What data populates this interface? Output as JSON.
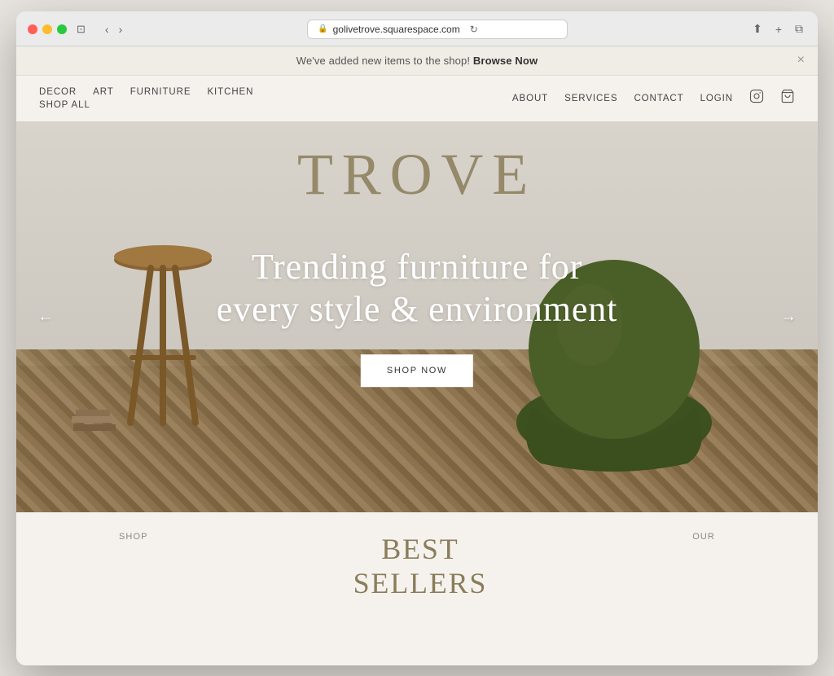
{
  "browser": {
    "url": "golivetrove.squarespace.com",
    "close_label": "×",
    "back_label": "‹",
    "forward_label": "›",
    "window_icon_label": "⧉",
    "share_label": "⬆",
    "add_tab_label": "+",
    "duplicate_label": "⧉",
    "window_toggle_label": "⊡"
  },
  "announcement": {
    "text": "We've added new items to the shop! ",
    "link_text": "Browse Now",
    "close_label": "×"
  },
  "nav": {
    "left_items": [
      {
        "label": "DECOR",
        "id": "decor"
      },
      {
        "label": "ART",
        "id": "art"
      },
      {
        "label": "FURNITURE",
        "id": "furniture"
      },
      {
        "label": "KITCHEN",
        "id": "kitchen"
      }
    ],
    "left_items_row2": [
      {
        "label": "SHOP ALL",
        "id": "shop-all"
      }
    ],
    "right_items": [
      {
        "label": "ABOUT",
        "id": "about"
      },
      {
        "label": "SERVICES",
        "id": "services"
      },
      {
        "label": "CONTACT",
        "id": "contact"
      },
      {
        "label": "LOGIN",
        "id": "login"
      }
    ],
    "instagram_icon": "𝕀",
    "cart_icon": "⌂"
  },
  "hero": {
    "brand_name": "TROVE",
    "headline_line1": "Trending furniture for",
    "headline_line2": "every style & environment",
    "cta_label": "SHOP NOW",
    "arrow_left": "←",
    "arrow_right": "→"
  },
  "below_fold": {
    "col1_label": "SHOP",
    "col1_heading_partial": "BEST",
    "col2_heading_partial": "SELLERS",
    "col3_label": "OUR"
  },
  "colors": {
    "brand_gold": "#8a7d5a",
    "bg_cream": "#f5f2ee",
    "nav_text": "#444444",
    "cta_bg": "#ffffff",
    "cta_text": "#333333"
  }
}
